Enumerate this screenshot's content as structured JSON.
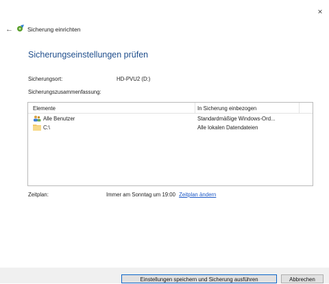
{
  "window": {
    "close_glyph": "×"
  },
  "header": {
    "back_glyph": "←",
    "title": "Sicherung einrichten"
  },
  "main": {
    "heading": "Sicherungseinstellungen prüfen",
    "backup_location_label": "Sicherungsort:",
    "backup_location_value": "HD-PVU2 (D:)",
    "summary_label": "Sicherungszusammenfassung:",
    "table": {
      "columns": [
        "Elemente",
        "In Sicherung einbezogen"
      ],
      "rows": [
        {
          "icon": "users-icon",
          "item": "Alle Benutzer",
          "included": "Standardmäßige Windows-Ord..."
        },
        {
          "icon": "folder-icon",
          "item": "C:\\",
          "included": "Alle lokalen Datendateien"
        }
      ]
    },
    "schedule_label": "Zeitplan:",
    "schedule_value": "Immer am Sonntag um 19:00",
    "schedule_link": "Zeitplan ändern"
  },
  "footer": {
    "primary_button": "Einstellungen speichern und Sicherung ausführen",
    "cancel_button": "Abbrechen"
  },
  "colors": {
    "heading": "#1f4e8c",
    "link": "#1a57c6",
    "footer_bg": "#f0f0f0"
  }
}
